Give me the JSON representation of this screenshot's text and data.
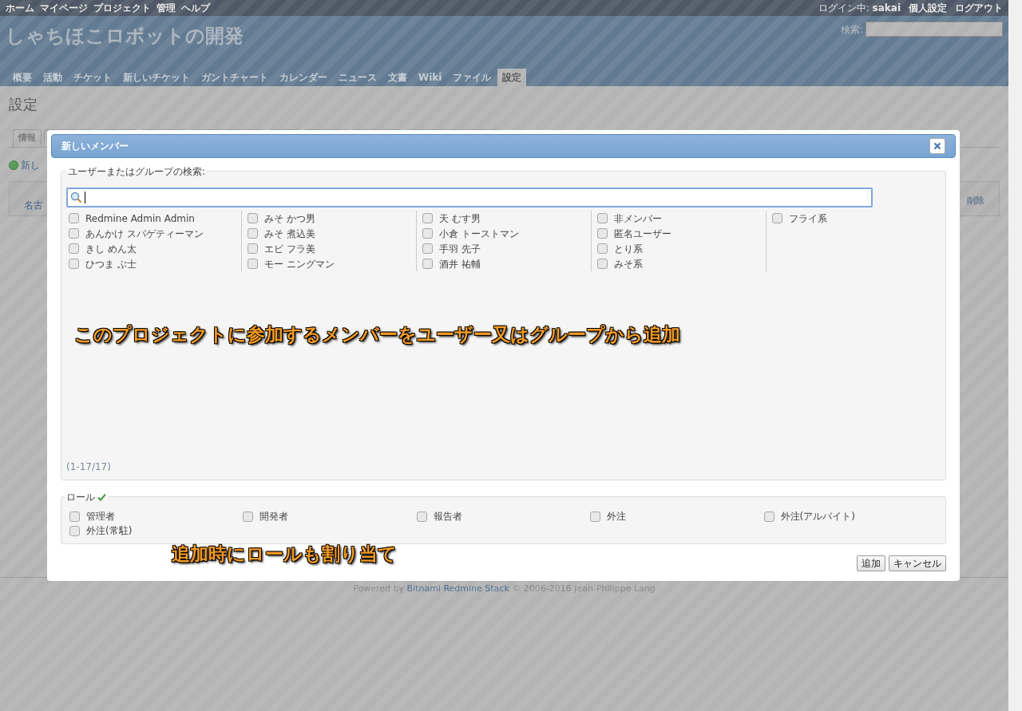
{
  "top_menu": [
    "ホーム",
    "マイページ",
    "プロジェクト",
    "管理",
    "ヘルプ"
  ],
  "account": {
    "logged_in_label": "ログイン中:",
    "user": "sakai",
    "links": [
      "個人設定",
      "ログアウト"
    ]
  },
  "project_title": "しゃちほこロボットの開発",
  "search": {
    "label": "検索:"
  },
  "main_tabs": [
    {
      "label": "概要",
      "selected": false
    },
    {
      "label": "活動",
      "selected": false
    },
    {
      "label": "チケット",
      "selected": false
    },
    {
      "label": "新しいチケット",
      "selected": false
    },
    {
      "label": "ガントチャート",
      "selected": false
    },
    {
      "label": "カレンダー",
      "selected": false
    },
    {
      "label": "ニュース",
      "selected": false
    },
    {
      "label": "文書",
      "selected": false
    },
    {
      "label": "Wiki",
      "selected": false
    },
    {
      "label": "ファイル",
      "selected": false
    },
    {
      "label": "設定",
      "selected": true
    }
  ],
  "page_title": "設定",
  "settings_tab": "情報",
  "new_member_link": "新し",
  "table": {
    "cell": "名古",
    "delete_link": "削除"
  },
  "dialog": {
    "title": "新しいメンバー",
    "search_legend": "ユーザーまたはグループの検索:",
    "principal_columns": [
      [
        {
          "label": "Redmine Admin Admin",
          "checked": false
        },
        {
          "label": "あんかけ スパゲティーマン",
          "checked": false
        },
        {
          "label": "きし めん太",
          "checked": false
        },
        {
          "label": "ひつま ぶ士",
          "checked": false
        }
      ],
      [
        {
          "label": "みそ かつ男",
          "checked": false
        },
        {
          "label": "みそ 煮込美",
          "checked": false
        },
        {
          "label": "エビ フラ美",
          "checked": false
        },
        {
          "label": "モー ニングマン",
          "checked": false
        }
      ],
      [
        {
          "label": "天 むす男",
          "checked": false
        },
        {
          "label": "小倉 トーストマン",
          "checked": false
        },
        {
          "label": "手羽 先子",
          "checked": false
        },
        {
          "label": "酒井 祐輔",
          "checked": false
        }
      ],
      [
        {
          "label": "非メンバー",
          "checked": false
        },
        {
          "label": "匿名ユーザー",
          "checked": false
        },
        {
          "label": "とり系",
          "checked": false
        },
        {
          "label": "みそ系",
          "checked": false
        }
      ],
      [
        {
          "label": "フライ系",
          "checked": false
        }
      ]
    ],
    "count": "(1-17/17)",
    "roles_legend": "ロール",
    "roles": [
      {
        "label": "管理者",
        "checked": false
      },
      {
        "label": "開発者",
        "checked": false
      },
      {
        "label": "報告者",
        "checked": false
      },
      {
        "label": "外注",
        "checked": false
      },
      {
        "label": "外注(アルバイト)",
        "checked": false
      },
      {
        "label": "外注(常駐)",
        "checked": false
      }
    ],
    "buttons": [
      "追加",
      "キャンセル"
    ]
  },
  "annotations": [
    "このプロジェクトに参加するメンバーをユーザー又はグループから追加",
    "追加時にロールも割り当て"
  ],
  "footer": {
    "prefix": "Powered by",
    "link": "Bitnami Redmine Stack",
    "suffix": "© 2006-2016 Jean-Philippe Lang"
  }
}
